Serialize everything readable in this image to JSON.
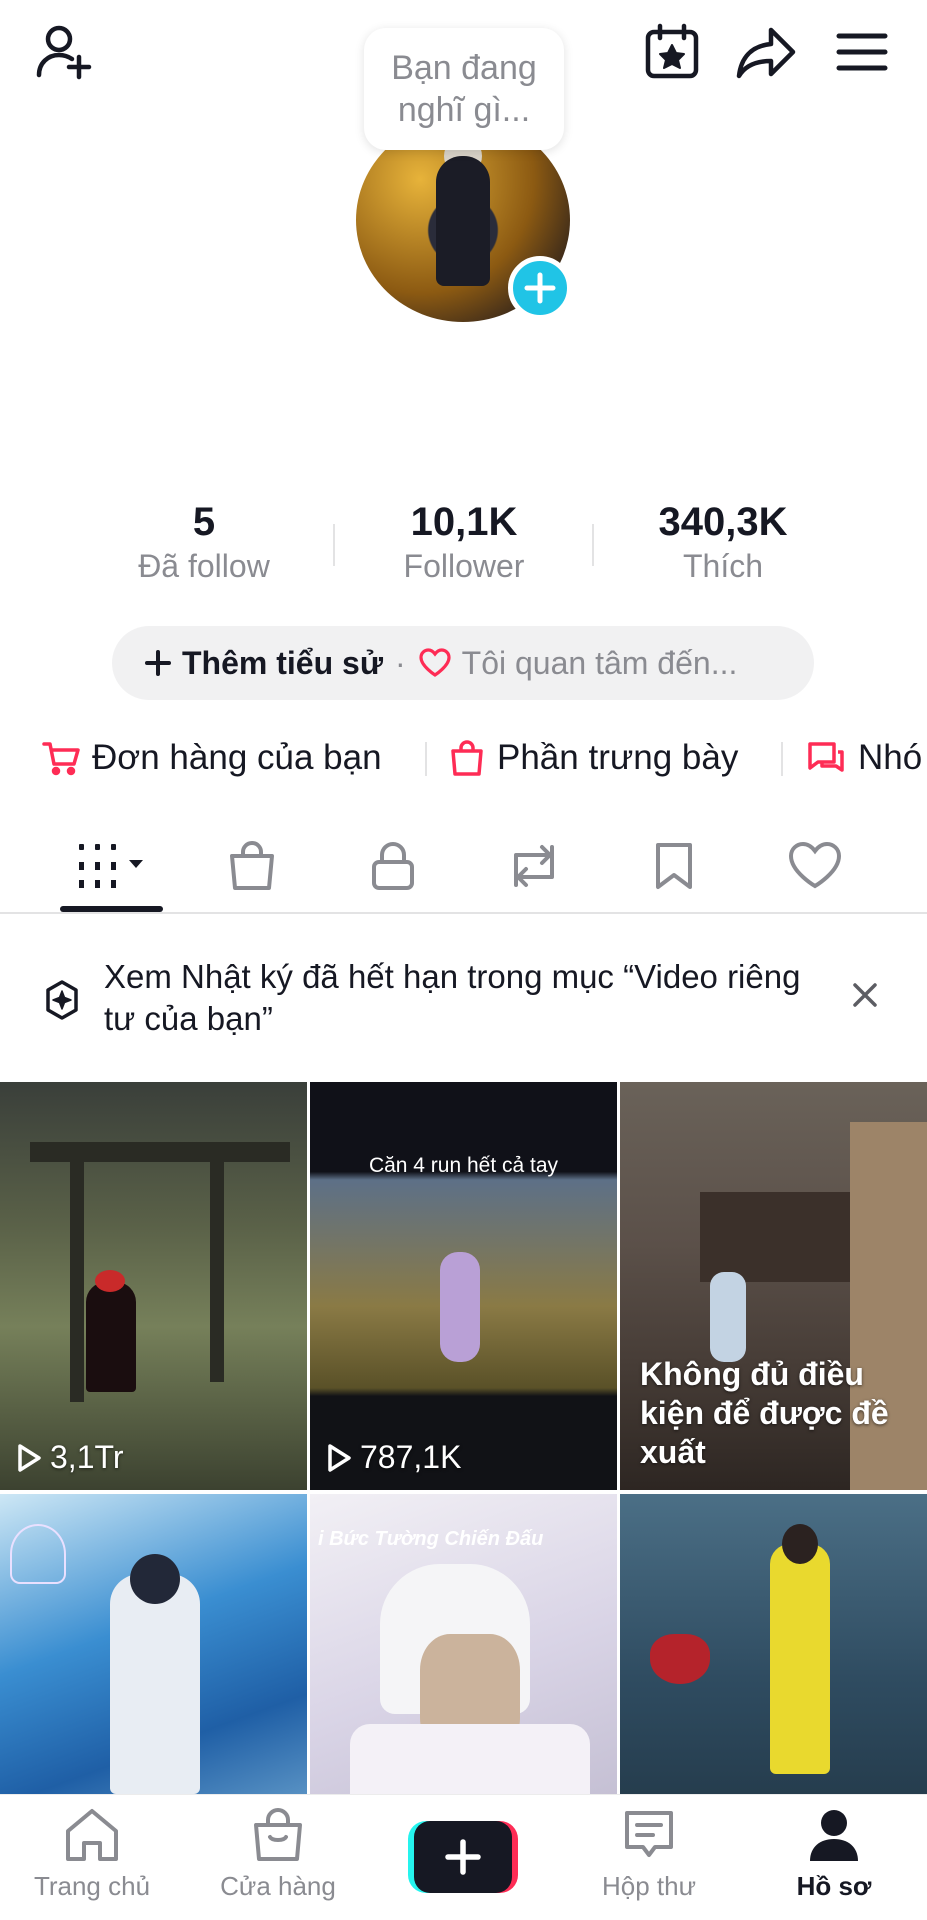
{
  "header": {
    "bubble_text": "Bạn đang nghĩ gì...",
    "icons": [
      "add-friend-icon",
      "calendar-star-icon",
      "share-icon",
      "menu-icon"
    ]
  },
  "stats": [
    {
      "value": "5",
      "label": "Đã follow"
    },
    {
      "value": "10,1K",
      "label": "Follower"
    },
    {
      "value": "340,3K",
      "label": "Thích"
    }
  ],
  "bio": {
    "add_bio": "Thêm tiểu sử",
    "separator": "·",
    "interest": "Tôi quan tâm đến..."
  },
  "shortcuts": [
    {
      "label": "Đơn hàng của bạn",
      "icon": "cart-icon"
    },
    {
      "label": "Phần trưng bày",
      "icon": "bag-icon"
    },
    {
      "label": "Nhó",
      "icon": "chat-group-icon"
    }
  ],
  "tabs": [
    "videos-grid-icon",
    "shop-bag-icon",
    "lock-icon",
    "repost-icon",
    "bookmark-icon",
    "heart-icon"
  ],
  "notice": {
    "text": "Xem Nhật ký đã hết hạn trong mục “Video riêng tư của bạn”"
  },
  "videos": [
    {
      "views": "3,1Tr"
    },
    {
      "views": "787,1K",
      "caption": "Căn 4 run hết cả tay"
    },
    {
      "warning": "Không đủ điều kiện để được đề xuất"
    },
    {},
    {
      "caption": "i Bức Tường Chiến Đấu"
    },
    {}
  ],
  "bottom_nav": [
    {
      "label": "Trang chủ",
      "icon": "home-icon"
    },
    {
      "label": "Cửa hàng",
      "icon": "shop-icon"
    },
    {
      "label": "",
      "icon": "plus-icon"
    },
    {
      "label": "Hộp thư",
      "icon": "inbox-icon"
    },
    {
      "label": "Hồ sơ",
      "icon": "profile-icon"
    }
  ],
  "colors": {
    "accent_red": "#fe2c55",
    "accent_cyan": "#20c4e6",
    "text_primary": "#161823",
    "text_secondary": "#8a8b91"
  }
}
